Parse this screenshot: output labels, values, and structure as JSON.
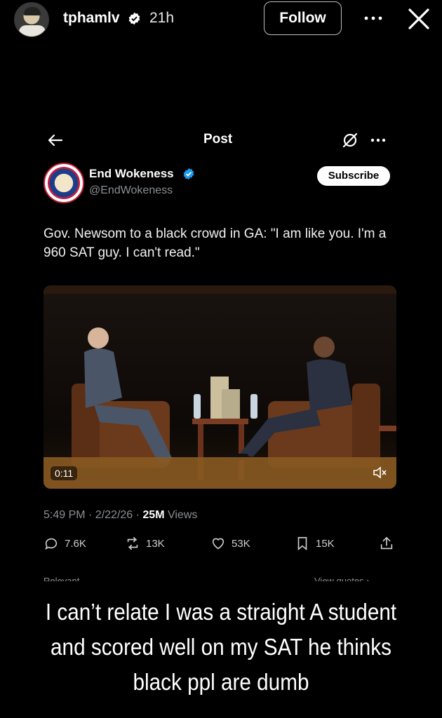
{
  "story": {
    "username": "tphamlv",
    "time_ago": "21h",
    "follow_label": "Follow",
    "caption": "I can’t relate I was a straight A student and scored well on my SAT he thinks black ppl are dumb"
  },
  "post": {
    "header_title": "Post",
    "account_name": "End Wokeness",
    "account_handle": "@EndWokeness",
    "subscribe_label": "Subscribe",
    "text": "Gov. Newsom to a black crowd in GA: \"I am like you. I'm a 960 SAT guy. I can't read.\"",
    "video_time": "0:11",
    "timestamp": "5:49 PM · 2/22/26 · ",
    "views_count": "25M",
    "views_label": " Views",
    "replies": "7.6K",
    "reposts": "13K",
    "likes": "53K",
    "bookmarks": "15K",
    "relevant_label": "Relevant ⌄",
    "view_quotes_label": "View quotes ›"
  },
  "icons": [
    "verified-badge",
    "more-icon",
    "close-icon",
    "back-arrow-icon",
    "grok-icon",
    "reply-icon",
    "repost-icon",
    "like-icon",
    "bookmark-icon",
    "share-icon",
    "mute-icon"
  ],
  "colors": {
    "background": "#000000",
    "verified_blue": "#1d9bf0",
    "muted_text": "#8b8f94"
  }
}
